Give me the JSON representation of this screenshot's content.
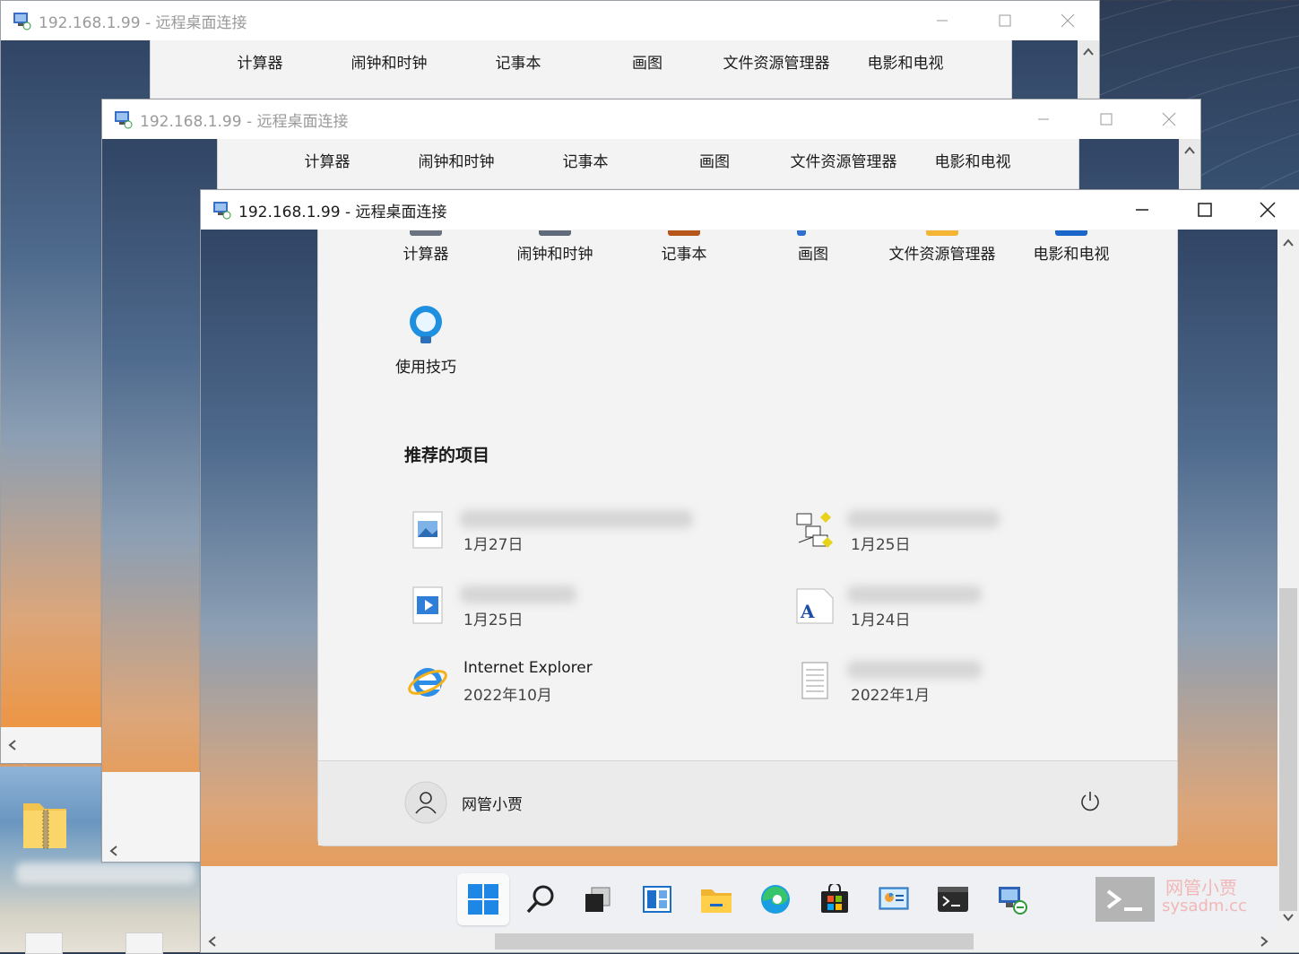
{
  "window_title": "192.168.1.99 - 远程桌面连接",
  "pinned_apps": [
    "计算器",
    "闹钟和时钟",
    "记事本",
    "画图",
    "文件资源管理器",
    "电影和电视"
  ],
  "extra_app": "使用技巧",
  "recommended": {
    "title": "推荐的项目",
    "items": [
      {
        "name": "",
        "date": "1月27日",
        "icon": "image-file-icon"
      },
      {
        "name": "",
        "date": "1月25日",
        "icon": "network-app-icon"
      },
      {
        "name": "",
        "date": "1月25日",
        "icon": "video-file-icon"
      },
      {
        "name": "",
        "date": "1月24日",
        "icon": "font-file-icon"
      },
      {
        "name": "Internet Explorer",
        "date": "2022年10月",
        "icon": "internet-explorer-icon"
      },
      {
        "name": "",
        "date": "2022年1月",
        "icon": "text-document-icon"
      }
    ]
  },
  "user": {
    "name": "网管小贾"
  },
  "taskbar": [
    "start-icon",
    "search-icon",
    "task-view-icon",
    "widgets-icon",
    "file-explorer-icon",
    "edge-icon",
    "store-icon",
    "control-panel-icon",
    "terminal-icon",
    "remote-desktop-icon"
  ],
  "watermark": {
    "line1": "网管小贾",
    "line2": "sysadm.cc"
  }
}
